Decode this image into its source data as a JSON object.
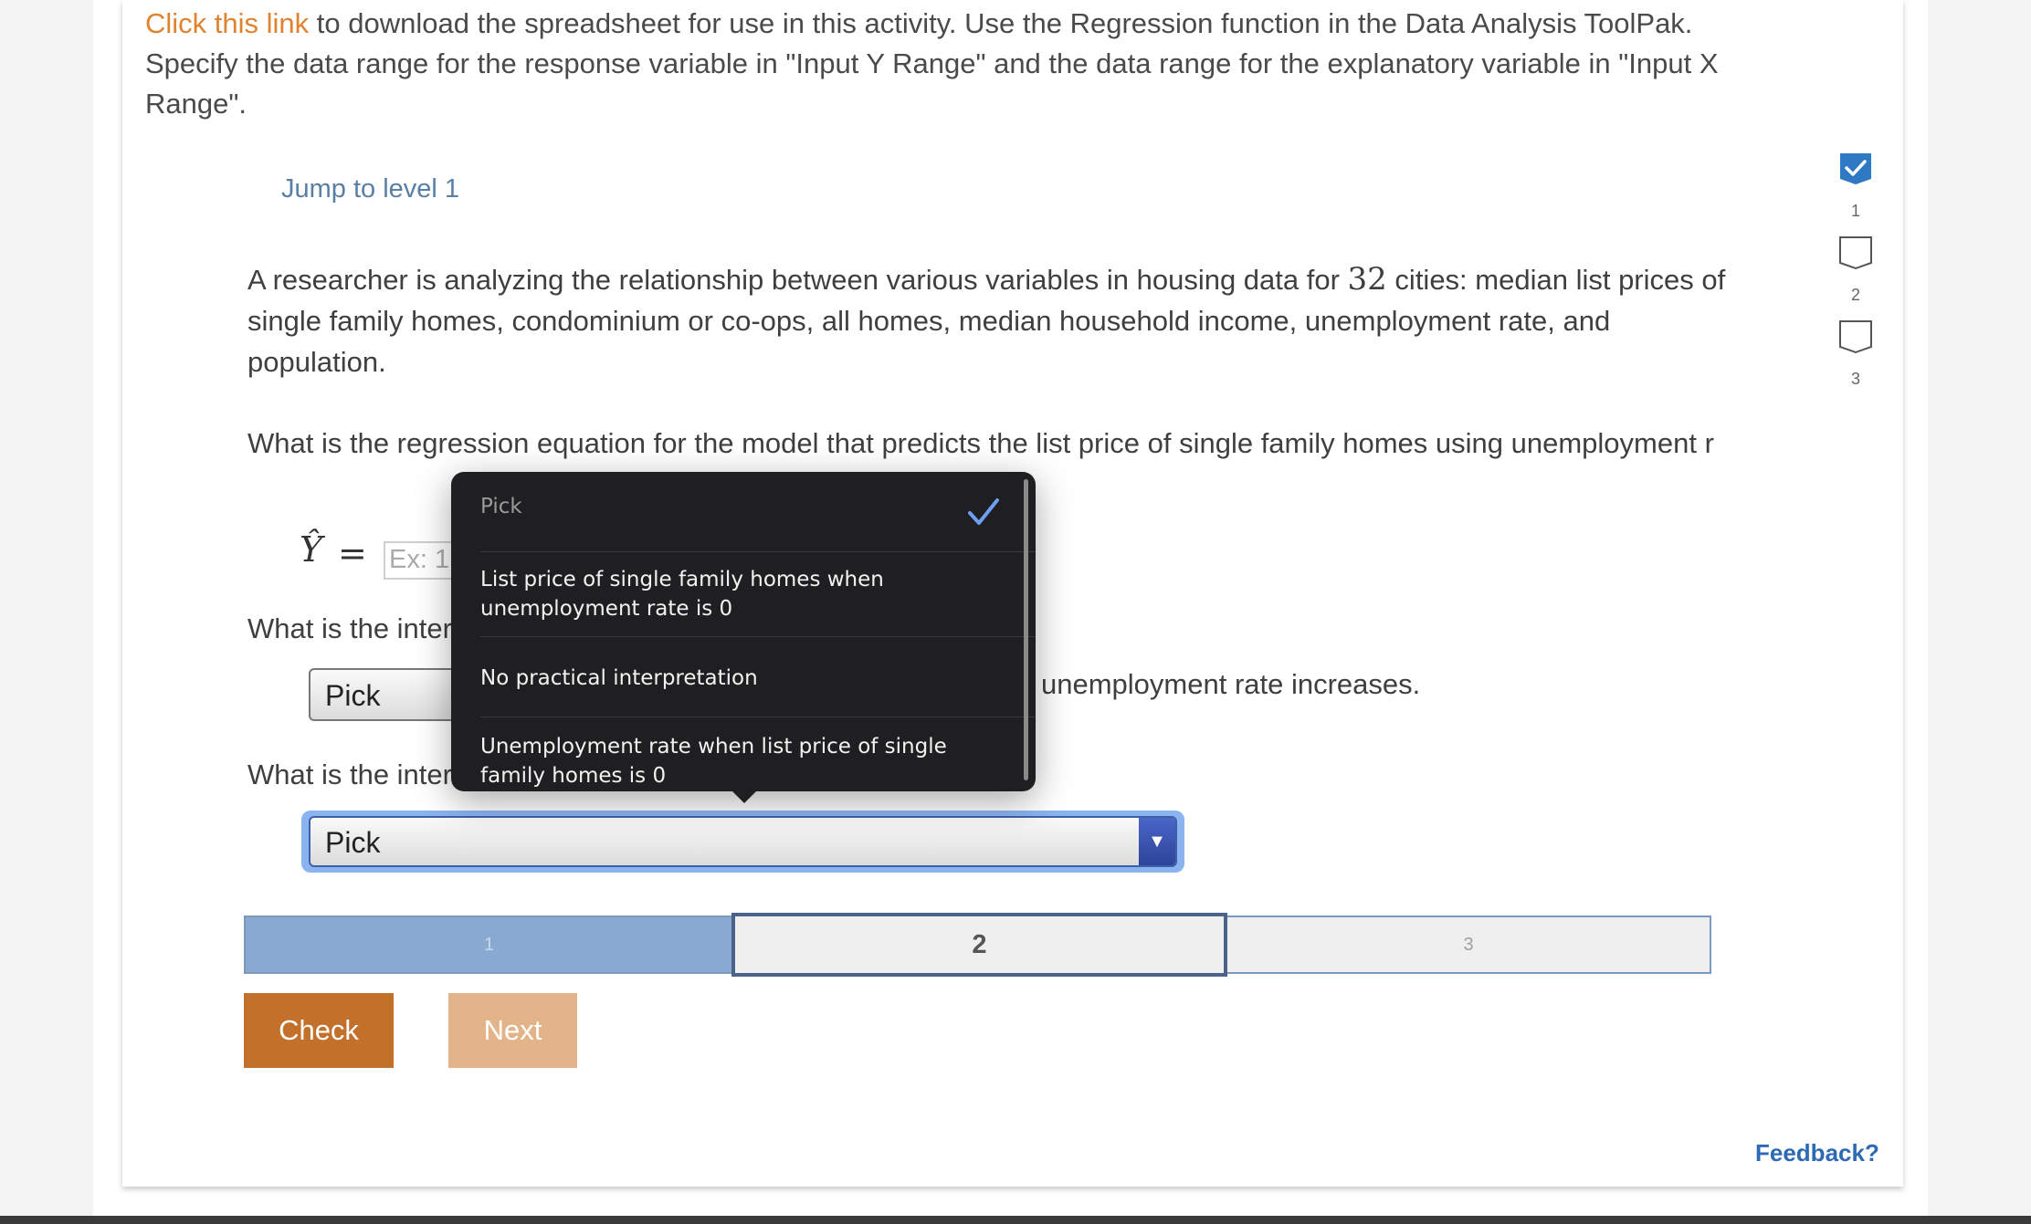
{
  "intro": {
    "link_text": "Click this link",
    "text": " to download the spreadsheet for use in this activity. Use the Regression function in the Data Analysis ToolPak. Specify the data range for the response variable in \"Input Y Range\" and the data range for the explanatory variable in \"Input X Range\"."
  },
  "jump_link": "Jump to level 1",
  "question1": {
    "pre": "A researcher is analyzing the relationship between various variables in housing data for ",
    "number": "32",
    "post": " cities: median list prices of single family homes, condominium or co-ops, all homes, median household income, unemployment rate, and population."
  },
  "question2": "What is the regression equation for the model that predicts the list price of single family homes using unemployment r",
  "equation": {
    "yhat": "Ŷ",
    "equals": "=",
    "placeholder": "Ex: 1"
  },
  "question3": "What is the inter",
  "select1": {
    "value": "Pick"
  },
  "tail_text": "unemployment rate increases.",
  "question4": "What is the inter",
  "select2": {
    "value": "Pick",
    "arrow": "▼"
  },
  "popup": {
    "options": [
      {
        "label": "Pick",
        "selected": true
      },
      {
        "label": "List price of single family homes when unemployment rate is 0"
      },
      {
        "label": "No practical interpretation"
      },
      {
        "label": "Unemployment rate when list price of single family homes is 0"
      }
    ]
  },
  "progress": {
    "seg1": "1",
    "seg2": "2",
    "seg3": "3"
  },
  "buttons": {
    "check": "Check",
    "next": "Next"
  },
  "feedback": "Feedback?",
  "levels": [
    {
      "num": "1",
      "done": true
    },
    {
      "num": "2",
      "done": false
    },
    {
      "num": "3",
      "done": false
    }
  ],
  "colors": {
    "link_orange": "#e0832f",
    "check_button": "#c2702a",
    "next_button": "#e3b489",
    "accent_blue": "#2f78c4"
  }
}
